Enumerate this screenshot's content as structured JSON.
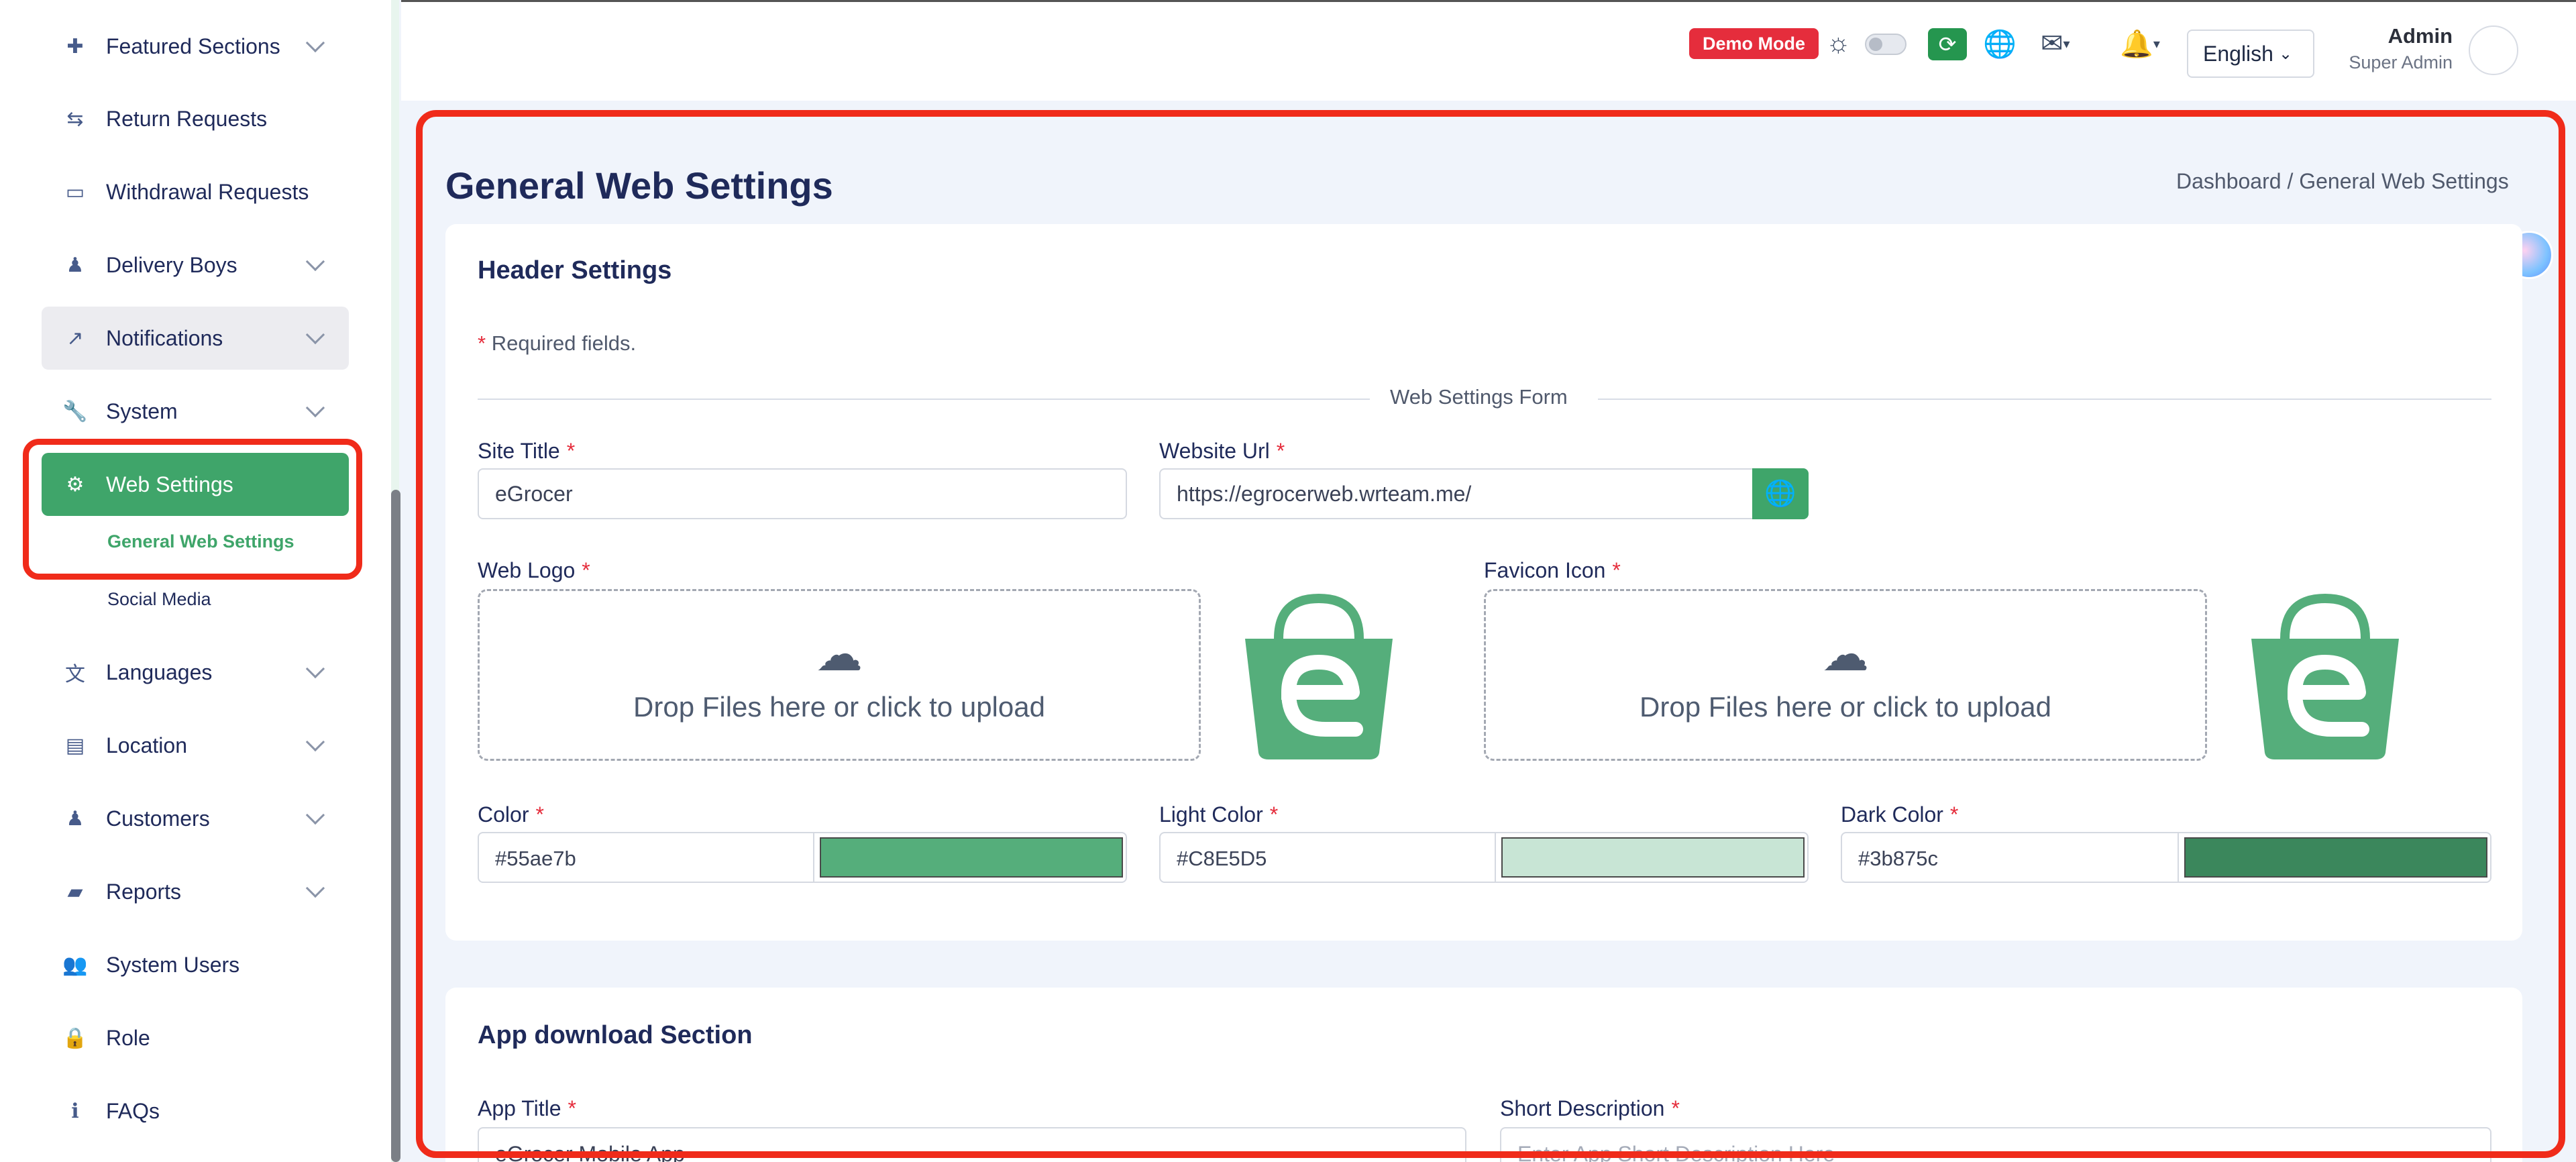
{
  "sidebar": {
    "items": [
      {
        "label": "Featured Sections",
        "icon": "puzzle-icon"
      },
      {
        "label": "Return Requests",
        "icon": "return-icon"
      },
      {
        "label": "Withdrawal Requests",
        "icon": "card-icon"
      },
      {
        "label": "Delivery Boys",
        "icon": "person-icon"
      },
      {
        "label": "Notifications",
        "icon": "share-icon"
      },
      {
        "label": "System",
        "icon": "wrench-icon"
      },
      {
        "label": "Web Settings",
        "icon": "gear-icon"
      },
      {
        "label": "Languages",
        "icon": "language-icon"
      },
      {
        "label": "Location",
        "icon": "map-icon"
      },
      {
        "label": "Customers",
        "icon": "person-icon"
      },
      {
        "label": "Reports",
        "icon": "folder-icon"
      },
      {
        "label": "System Users",
        "icon": "users-icon"
      },
      {
        "label": "Role",
        "icon": "lock-icon"
      },
      {
        "label": "FAQs",
        "icon": "info-icon"
      }
    ],
    "submenu": {
      "general": "General Web Settings",
      "social": "Social Media"
    }
  },
  "header": {
    "demo_badge": "Demo Mode",
    "language": "English",
    "user_name": "Admin",
    "user_role": "Super Admin"
  },
  "page": {
    "title": "General Web Settings",
    "breadcrumb": "Dashboard  /  General Web Settings"
  },
  "header_settings": {
    "title": "Header Settings",
    "required_note": "Required fields.",
    "star": "*",
    "divider": "Web Settings Form",
    "site_title_label": "Site Title",
    "site_title_value": "eGrocer",
    "website_url_label": "Website Url",
    "website_url_value": "https://egrocerweb.wrteam.me/",
    "web_logo_label": "Web Logo",
    "favicon_label": "Favicon Icon",
    "dropzone_text": "Drop Files here or click to upload",
    "color_label": "Color",
    "color_value": "#55ae7b",
    "light_color_label": "Light Color",
    "light_color_value": "#C8E5D5",
    "dark_color_label": "Dark Color",
    "dark_color_value": "#3b875c"
  },
  "app_download": {
    "title": "App download Section",
    "app_title_label": "App Title",
    "app_title_value": "eGrocer Mobile App",
    "short_desc_label": "Short Description",
    "short_desc_placeholder": "Enter App Short Description Here"
  },
  "colors": {
    "brand": "#3fa56a",
    "color_swatch": "#55ae7b",
    "light_swatch": "#C8E5D5",
    "dark_swatch": "#3b875c",
    "highlight": "#f02b1a"
  }
}
